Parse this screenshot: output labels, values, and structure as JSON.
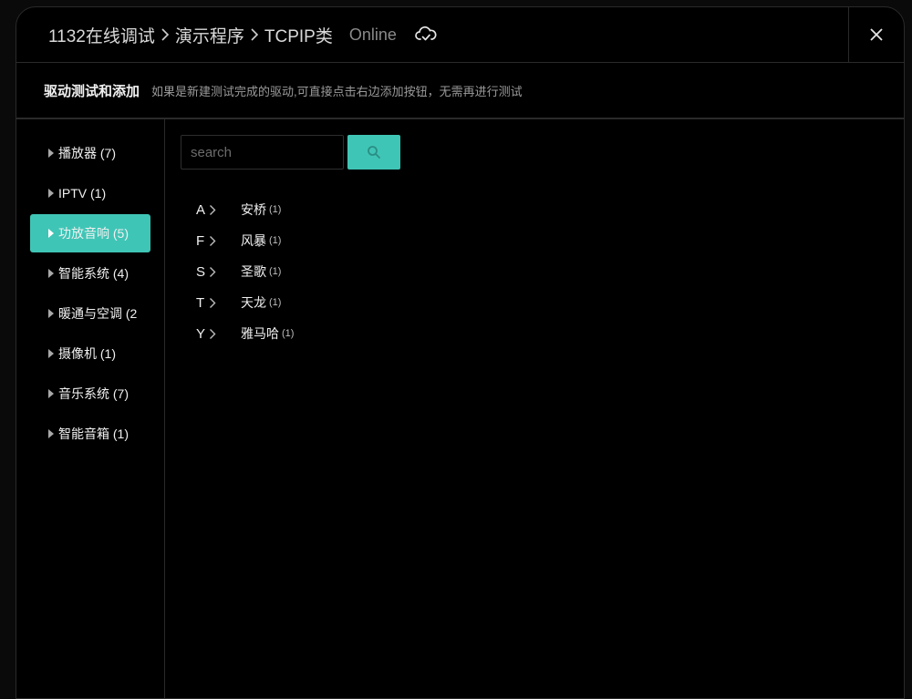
{
  "header": {
    "breadcrumbs": [
      "1132在线调试",
      "演示程序",
      "TCPIP类"
    ],
    "status": "Online",
    "cloud_icon": "cloud-sync-icon",
    "close_icon": "close-icon"
  },
  "subheader": {
    "title": "驱动测试和添加",
    "description": "如果是新建测试完成的驱动,可直接点击右边添加按钮，无需再进行测试"
  },
  "sidebar": {
    "items": [
      {
        "label": "播放器 (7)",
        "active": false
      },
      {
        "label": "IPTV (1)",
        "active": false
      },
      {
        "label": "功放音响 (5)",
        "active": true
      },
      {
        "label": "智能系统 (4)",
        "active": false
      },
      {
        "label": "暖通与空调 (2",
        "active": false
      },
      {
        "label": "摄像机 (1)",
        "active": false
      },
      {
        "label": "音乐系统 (7)",
        "active": false
      },
      {
        "label": "智能音箱 (1)",
        "active": false
      }
    ]
  },
  "search": {
    "placeholder": "search",
    "value": "",
    "button_icon": "search-icon"
  },
  "brands": [
    {
      "letter": "A",
      "name": "安桥",
      "count": "(1)"
    },
    {
      "letter": "F",
      "name": "风暴",
      "count": "(1)"
    },
    {
      "letter": "S",
      "name": "圣歌",
      "count": "(1)"
    },
    {
      "letter": "T",
      "name": "天龙",
      "count": "(1)"
    },
    {
      "letter": "Y",
      "name": "雅马哈",
      "count": "(1)"
    }
  ],
  "colors": {
    "accent": "#3fc5b6",
    "background": "#000000",
    "border": "#2a2a2a"
  }
}
